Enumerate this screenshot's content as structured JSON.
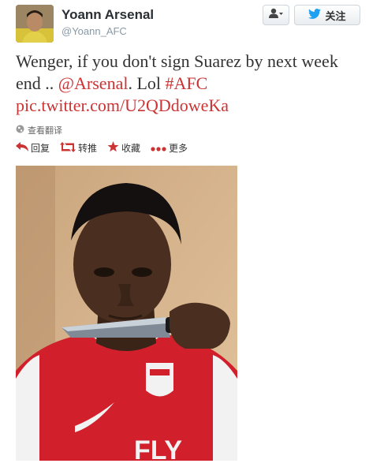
{
  "header": {
    "name": "Yoann Arsenal",
    "handle": "@Yoann_AFC",
    "follow_label": "关注"
  },
  "tweet": {
    "text_before": "Wenger, if you don't sign Suarez by next week end .. ",
    "mention": "@Arsenal",
    "text_middle": ". Lol ",
    "hashtag": "#AFC",
    "link": "pic.twitter.com/U2QDdoweKa"
  },
  "translate_label": "查看翻译",
  "actions": {
    "reply": "回复",
    "retweet": "转推",
    "favorite": "收藏",
    "more": "更多"
  },
  "colors": {
    "accent_red": "#cc3333",
    "twitter_blue": "#1da1f2"
  },
  "icons": [
    "user-icon",
    "twitter-bird-icon",
    "globe-icon",
    "reply-icon",
    "retweet-icon",
    "star-icon",
    "more-dots-icon"
  ]
}
